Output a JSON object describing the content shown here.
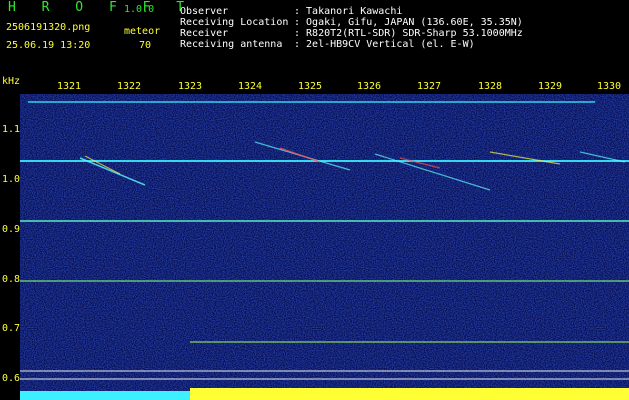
{
  "app": {
    "name": "H R O F F T",
    "version": "1.0.0",
    "filename": "2506191320.png",
    "datetime": "25.06.19 13:20",
    "meteor_label": "meteor",
    "meteor_count": "70"
  },
  "info": [
    {
      "label": "Observer",
      "value": ": Takanori Kawachi"
    },
    {
      "label": "Receiving Location",
      "value": ": Ogaki, Gifu, JAPAN (136.60E, 35.35N)"
    },
    {
      "label": "Receiver",
      "value": ": R820T2(RTL-SDR) SDR-Sharp 53.1000MHz"
    },
    {
      "label": "Receiving antenna",
      "value": ": 2el-HB9CV Vertical (el. E-W)"
    }
  ],
  "axis": {
    "y_unit": "kHz",
    "x_ticks": [
      "1321",
      "1322",
      "1323",
      "1324",
      "1325",
      "1326",
      "1327",
      "1328",
      "1329",
      "1330"
    ],
    "y_ticks": [
      "1.1",
      "1.0",
      "0.9",
      "0.8",
      "0.7",
      "0.6"
    ]
  },
  "colors": {
    "label_yellow": "#ffff33",
    "label_green": "#2ee82e",
    "noise_blue": "#0a1c8c",
    "signal_cyan": "#3cf0ff"
  }
}
